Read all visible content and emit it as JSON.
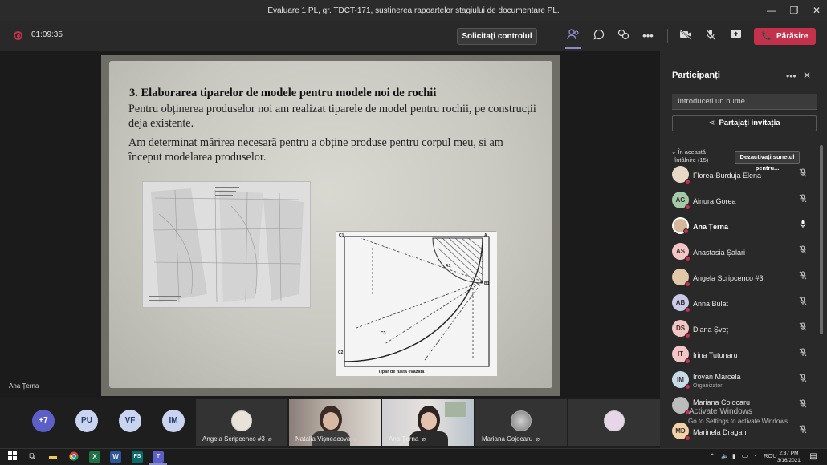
{
  "window": {
    "title": "Evaluare 1 PL, gr. TDCT-171, susținerea rapoartelor stagiului de documentare PL.",
    "minimize": "—",
    "maximize": "❐",
    "close": "✕"
  },
  "meeting_bar": {
    "timer": "01:09:35",
    "take_control": "Solicitați controlul",
    "leave": "Părăsire",
    "leave_icon": "📞"
  },
  "slide": {
    "title": "3. Elaborarea tiparelor de modele pentru modele noi de rochii",
    "paragraph1": "Pentru obținerea produselor noi am realizat tiparele de model pentru rochii, pe construcții deja existente.",
    "paragraph2": "Am determinat mărirea necesară pentru a obține produse pentru corpul meu, si am început modelarea produselor.",
    "drawing_caption": "Tipar de fusta evazata",
    "drawing_labels": [
      "C1",
      "A",
      "B1",
      "C2",
      "C3",
      "A1"
    ]
  },
  "stage": {
    "speaker_name": "Ana Țerna"
  },
  "panel": {
    "title": "Participanți",
    "more": "•••",
    "close": "✕",
    "search_placeholder": "Introduceți un nume",
    "share_label": "Partajați invitația",
    "share_icon": "⋖",
    "in_meeting_line1": "În această",
    "in_meeting_line2": "întâlnire (15)",
    "mute_all": "Dezactivați sunetul pentru...",
    "participants": [
      {
        "initials": "",
        "name": "Florea-Burduja Elena",
        "role": "",
        "color": "#e8d9c7"
      },
      {
        "initials": "AG",
        "name": "Ainura Gorea",
        "role": "",
        "color": "#a3c9a8"
      },
      {
        "initials": "",
        "name": "Ana Țerna",
        "role": "",
        "color": "#d6b79a"
      },
      {
        "initials": "AS",
        "name": "Anastasia Șalari",
        "role": "",
        "color": "#f3c6c6"
      },
      {
        "initials": "",
        "name": "Angela Scripcenco #3",
        "role": "",
        "color": "#e0c8a8"
      },
      {
        "initials": "AB",
        "name": "Anna Bulat",
        "role": "",
        "color": "#c9c9e8"
      },
      {
        "initials": "DS",
        "name": "Diana Șveț",
        "role": "",
        "color": "#f3c6c6"
      },
      {
        "initials": "IT",
        "name": "Irina Tutunaru",
        "role": "",
        "color": "#f3c6c6"
      },
      {
        "initials": "IM",
        "name": "Irovan Marcela",
        "role": "Organizator",
        "color": "#c7dbe8"
      },
      {
        "initials": "",
        "name": "Mariana Cojocaru",
        "role": "",
        "color": "#bbbbbb"
      },
      {
        "initials": "MD",
        "name": "Marinela Dragan",
        "role": "",
        "color": "#f2d3a8"
      }
    ]
  },
  "windows_notice": {
    "line1": "Activate Windows",
    "line2": "Go to Settings to activate Windows."
  },
  "strip": {
    "avatars": [
      {
        "initials": "+7",
        "color": "#5b5fc7",
        "text": "#ffffff"
      },
      {
        "initials": "PU",
        "color": "#c9d4f0",
        "text": "#2b3a67"
      },
      {
        "initials": "VF",
        "color": "#c9d4f0",
        "text": "#2b3a67"
      },
      {
        "initials": "IM",
        "color": "#c9d4f0",
        "text": "#2b3a67"
      }
    ],
    "tiles": [
      {
        "name": "Angela Scripcenco #3"
      },
      {
        "name": "Natalia Vișneacova"
      },
      {
        "name": "Ana Țerna"
      },
      {
        "name": "Mariana Cojocaru"
      }
    ]
  },
  "taskbar": {
    "lang": "ROU",
    "time": "2:37 PM",
    "date": "3/16/2021"
  }
}
